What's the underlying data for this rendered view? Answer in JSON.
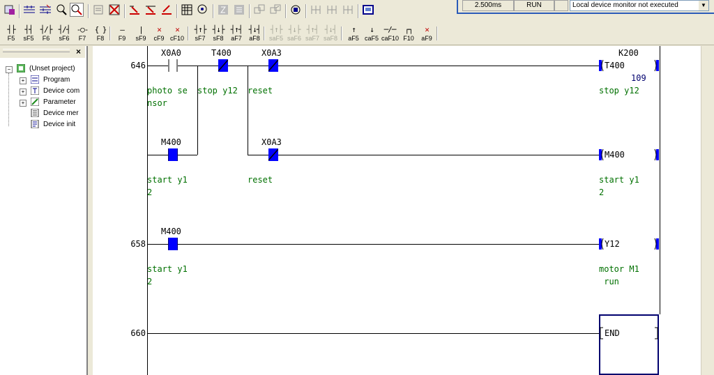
{
  "toolbar1": {
    "buttons": [
      "project-icon",
      "ladder-read-icon",
      "ladder-write-icon",
      "find-icon",
      "monitor-mode-icon",
      "print-icon",
      "delete-icon",
      "convert-icon",
      "convert-all-icon",
      "edit-icon",
      "device-list-icon",
      "diagnostics-icon",
      "step-icon",
      "step-all-icon",
      "split-icon",
      "merge-icon",
      "zoom-icon",
      "column-icon",
      "column2-icon",
      "column3-icon",
      "window-icon"
    ]
  },
  "toolbar2": {
    "keys": [
      {
        "sym": "┤├",
        "label": "F5",
        "enabled": true
      },
      {
        "sym": "┤┤",
        "label": "sF5",
        "enabled": true
      },
      {
        "sym": "┤/├",
        "label": "F6",
        "enabled": true
      },
      {
        "sym": "┤/┤",
        "label": "sF6",
        "enabled": true
      },
      {
        "sym": "-○-",
        "label": "F7",
        "enabled": true
      },
      {
        "sym": "{ }",
        "label": "F8",
        "enabled": true
      },
      {
        "sym": "—",
        "label": "F9",
        "enabled": true
      },
      {
        "sym": "|",
        "label": "sF9",
        "enabled": true
      },
      {
        "sym": "✕",
        "label": "cF9",
        "enabled": true
      },
      {
        "sym": "✕",
        "label": "cF10",
        "enabled": true
      },
      {
        "sym": "┤↑├",
        "label": "sF7",
        "enabled": true
      },
      {
        "sym": "┤↓├",
        "label": "sF8",
        "enabled": true
      },
      {
        "sym": "┤↑┤",
        "label": "aF7",
        "enabled": true
      },
      {
        "sym": "┤↓┤",
        "label": "aF8",
        "enabled": true
      },
      {
        "sym": "┤↑├",
        "label": "saF5",
        "enabled": false
      },
      {
        "sym": "┤↓├",
        "label": "saF6",
        "enabled": false
      },
      {
        "sym": "┤↑┤",
        "label": "saF7",
        "enabled": false
      },
      {
        "sym": "┤↓┤",
        "label": "saF8",
        "enabled": false
      },
      {
        "sym": "↑",
        "label": "aF5",
        "enabled": true
      },
      {
        "sym": "↓",
        "label": "caF5",
        "enabled": true
      },
      {
        "sym": "─/─",
        "label": "caF10",
        "enabled": true
      },
      {
        "sym": "┌┐",
        "label": "F10",
        "enabled": true
      },
      {
        "sym": "✕",
        "label": "aF9",
        "enabled": true
      }
    ]
  },
  "monitor": {
    "scan_time": "2.500ms",
    "status": "RUN",
    "select_value": "Local device monitor not executed"
  },
  "tree": {
    "root": "(Unset project)",
    "items": [
      "Program",
      "Device com",
      "Parameter",
      "Device mer",
      "Device init"
    ]
  },
  "ladder": {
    "steps": [
      {
        "number": "646"
      },
      {
        "number": "658"
      },
      {
        "number": "660"
      }
    ],
    "devices": {
      "x0a0_646": "X0A0",
      "t400_646": "T400",
      "x0a3_646": "X0A3",
      "m400_646": "M400",
      "x0a3_646b": "X0A3",
      "m400_658": "M400",
      "k200": "K200",
      "coil_t400": "T400",
      "coil_m400": "M400",
      "coil_y12": "Y12",
      "coil_end": "END"
    },
    "timer_current": "109",
    "comments": {
      "photo_sensor": "photo se\nnsor",
      "stop_y12_a": "stop y12",
      "reset_a": "reset",
      "stop_y12_coil": "stop y12",
      "start_y12_a": "start y1\n2",
      "reset_b": "reset",
      "start_y12_coil": "start y1\n2",
      "start_y12_b": "start y1\n2",
      "motor_m1_run": "motor M1\n run"
    },
    "colors": {
      "contact_on": "#0000ff",
      "comment": "#007000",
      "value": "#00006e"
    }
  }
}
